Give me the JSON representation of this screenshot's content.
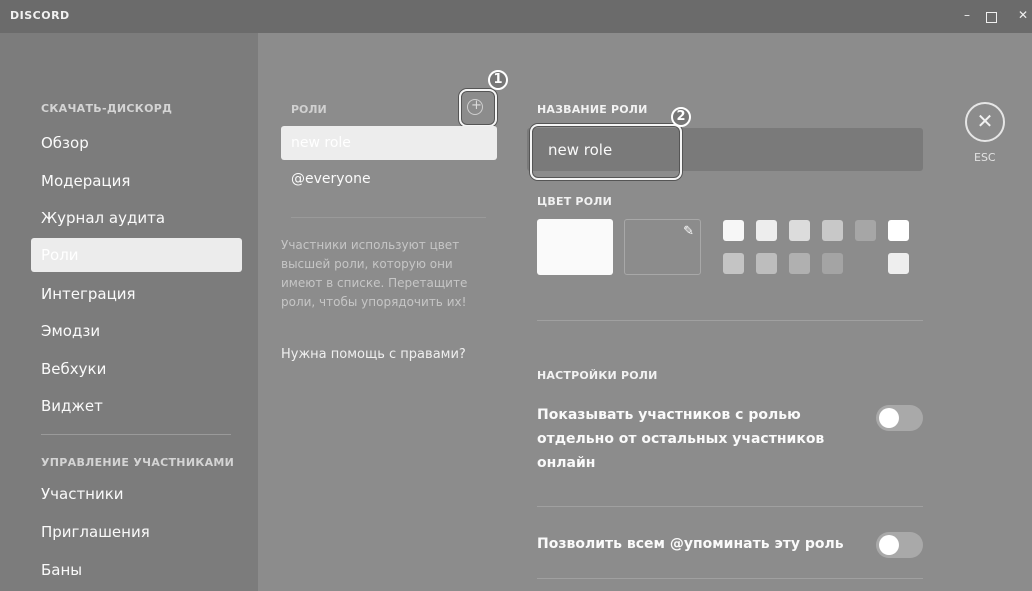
{
  "window": {
    "brand": "DISCORD",
    "min_glyph": "–",
    "close_glyph": "✕"
  },
  "sidebar": {
    "section1": "СКАЧАТЬ-ДИСКОРД",
    "items": [
      {
        "label": "Обзор"
      },
      {
        "label": "Модерация"
      },
      {
        "label": "Журнал аудита"
      },
      {
        "label": "Роли",
        "active": true
      },
      {
        "label": "Интеграция"
      },
      {
        "label": "Эмодзи"
      },
      {
        "label": "Вебхуки"
      },
      {
        "label": "Виджет"
      }
    ],
    "section2": "УПРАВЛЕНИЕ УЧАСТНИКАМИ",
    "items2": [
      {
        "label": "Участники"
      },
      {
        "label": "Приглашения"
      },
      {
        "label": "Баны"
      }
    ]
  },
  "roles_panel": {
    "header": "РОЛИ",
    "roles": [
      {
        "label": "new role",
        "selected": true
      },
      {
        "label": "@everyone"
      }
    ],
    "hint": "Участники используют цвет высшей роли, которую они имеют в списке. Перетащите роли, чтобы упорядочить их!",
    "help_link": "Нужна помощь с правами?"
  },
  "callouts": [
    "1",
    "2"
  ],
  "editor": {
    "name_label": "НАЗВАНИЕ РОЛИ",
    "name_value": "new role",
    "color_label": "ЦВЕТ РОЛИ",
    "swatch_colors": [
      "#f7f7f7",
      "#ededed",
      "#dcdcdc",
      "#c8c8c8",
      "#a6a6a6",
      "#ffffff",
      "#c4c4c4",
      "#bdbdbd",
      "#b0b0b0",
      "#a4a4a4",
      "#eeeeee"
    ],
    "settings_label": "НАСТРОЙКИ РОЛИ",
    "settings": [
      {
        "text": "Показывать участников с ролью отдельно от остальных участников онлайн",
        "enabled": false
      },
      {
        "text": "Позволить всем @упоминать эту роль",
        "enabled": false
      }
    ]
  },
  "close": {
    "glyph": "✕",
    "label": "ESC"
  },
  "icons": {
    "add_role": "plus-circle-icon",
    "eyedropper": "eyedropper-icon",
    "close": "close-icon"
  }
}
